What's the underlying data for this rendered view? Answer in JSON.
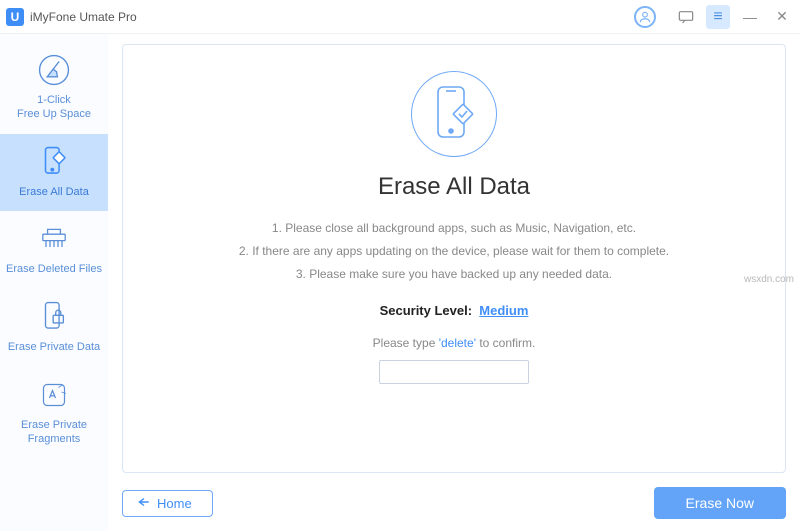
{
  "app": {
    "title": "iMyFone Umate Pro",
    "logo_letter": "U"
  },
  "sidebar": {
    "items": [
      {
        "label": "1-Click\nFree Up Space"
      },
      {
        "label": "Erase All Data"
      },
      {
        "label": "Erase Deleted Files"
      },
      {
        "label": "Erase Private Data"
      },
      {
        "label": "Erase Private\nFragments"
      }
    ]
  },
  "main": {
    "heading": "Erase All Data",
    "steps": [
      "1. Please close all background apps, such as Music, Navigation, etc.",
      "2. If there are any apps updating on the device, please wait for them to complete.",
      "3. Please make sure you have backed up any needed data."
    ],
    "security_label": "Security Level:",
    "security_value": "Medium",
    "confirm_prefix": "Please type ",
    "confirm_keyword": "'delete'",
    "confirm_suffix": " to confirm.",
    "input_value": ""
  },
  "footer": {
    "home": "Home",
    "erase": "Erase Now"
  },
  "watermark": "wsxdn.com"
}
